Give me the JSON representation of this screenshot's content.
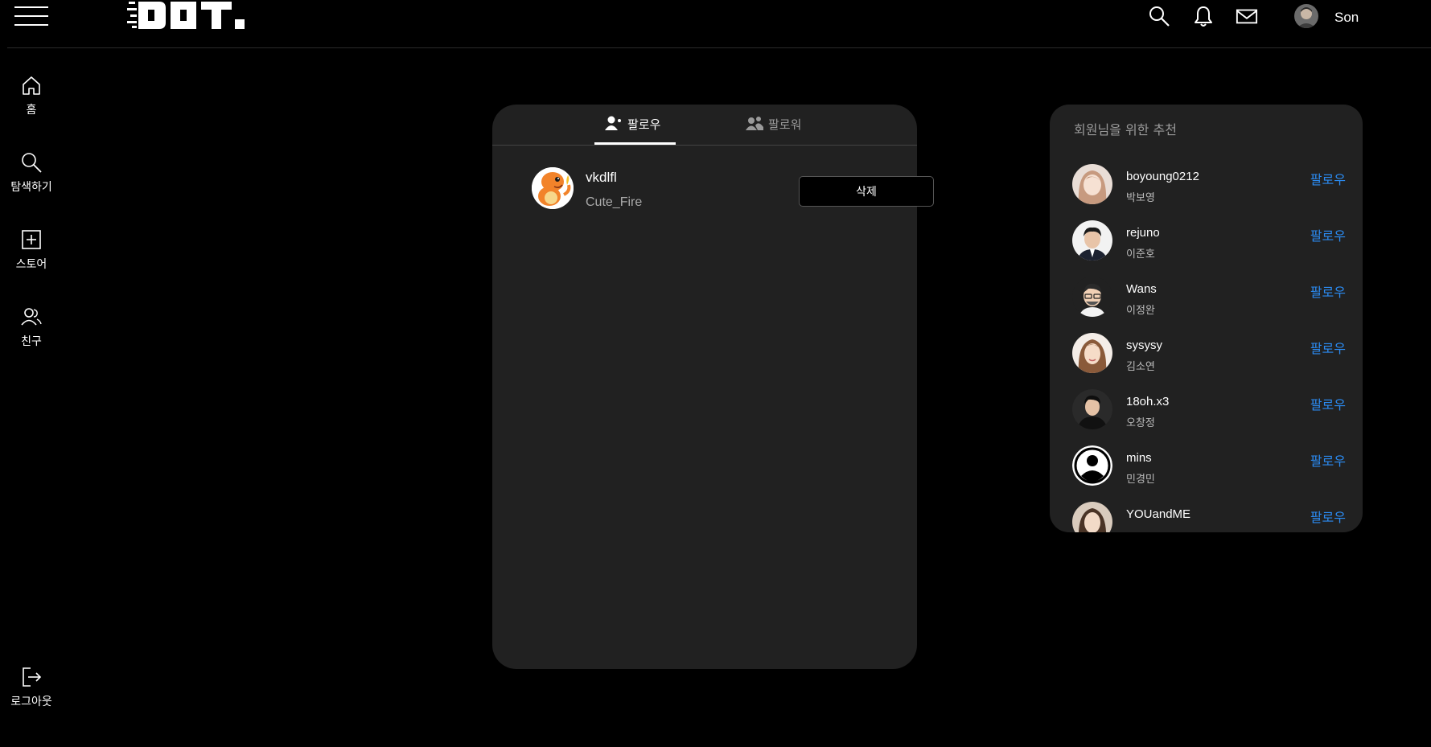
{
  "header": {
    "logo_text": "DOT.",
    "username": "Son",
    "icons": [
      "menu-icon",
      "search-icon",
      "bell-icon",
      "mail-icon"
    ]
  },
  "nav": {
    "items": [
      {
        "label": "홈",
        "icon": "home-icon"
      },
      {
        "label": "탐색하기",
        "icon": "search-icon"
      },
      {
        "label": "스토어",
        "icon": "plus-square-icon"
      },
      {
        "label": "친구",
        "icon": "friends-icon"
      }
    ],
    "logout": {
      "label": "로그아웃",
      "icon": "logout-icon"
    }
  },
  "follow": {
    "tabs": [
      {
        "label": "팔로우",
        "icon": "user-icon"
      },
      {
        "label": "팔로워",
        "icon": "users-icon"
      }
    ],
    "active_tab": 0,
    "rows": [
      {
        "username": "vkdlfl",
        "nickname": "Cute_Fire",
        "action": "삭제"
      }
    ]
  },
  "recommend": {
    "title": "회원님을 위한 추천",
    "follow_label": "팔로우",
    "users": [
      {
        "username": "boyoung0212",
        "name": "박보영"
      },
      {
        "username": "rejuno",
        "name": "이준호"
      },
      {
        "username": "Wans",
        "name": "이정완"
      },
      {
        "username": "sysysy",
        "name": "김소연"
      },
      {
        "username": "18oh.x3",
        "name": "오창정"
      },
      {
        "username": "mins",
        "name": "민경민"
      },
      {
        "username": "YOUandME",
        "name": ""
      }
    ]
  },
  "colors": {
    "background": "#000000",
    "card": "#212121",
    "accent_blue": "#2b8bf2"
  }
}
